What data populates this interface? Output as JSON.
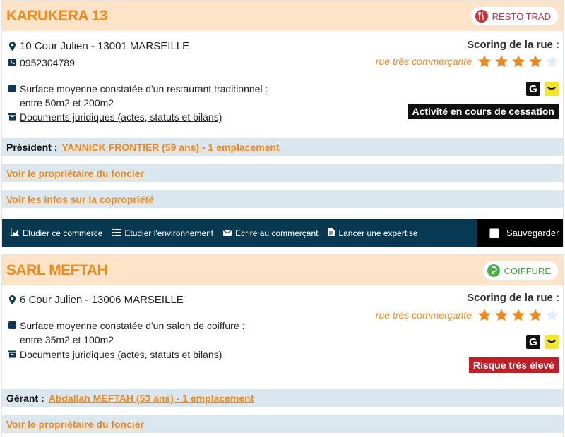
{
  "colors": {
    "accent": "#ee8a1d",
    "header_bg": "#fde4c9",
    "band_bg": "#dbe7ef",
    "toolbar_bg": "#073a52",
    "status_black": "#111111",
    "status_red": "#c31d25"
  },
  "cards": [
    {
      "title": "KARUKERA 13",
      "category": {
        "label": "RESTO TRAD",
        "icon": "cutlery-pin-icon"
      },
      "address": "10 Cour Julien - 13001 MARSEILLE",
      "phone": "0952304789",
      "surface_line1": "Surface moyenne constatée d'un restaurant traditionnel :",
      "surface_line2": "entre 50m2 et 200m2",
      "legal_docs": "Documents juridiques (actes, statuts et bilans)",
      "scoring_title": "Scoring de la rue :",
      "scoring_text": "rue très commerçante",
      "stars": 4,
      "stars_max": 5,
      "status": "Activité en cours de cessation",
      "role_label": "Président :",
      "role_link": "YANNICK FRONTIER (59 ans) - 1 emplacement",
      "link_owner": "Voir le propriétaire du foncier",
      "link_copro": "Voir les infos sur la copropriété",
      "toolbar": {
        "study_shop": "Etudier ce commerce",
        "study_env": "Etudier l'environnement",
        "write": "Ecrire au commerçant",
        "expertise": "Lancer une expertise",
        "save": "Sauvegarder"
      }
    },
    {
      "title": "SARL MEFTAH",
      "category": {
        "label": "COIFFURE",
        "icon": "hairdresser-pin-icon"
      },
      "address": "6 Cour Julien - 13006 MARSEILLE",
      "surface_line1": "Surface moyenne constatée d'un salon de coiffure :",
      "surface_line2": "entre 35m2 et 100m2",
      "legal_docs": "Documents juridiques (actes, statuts et bilans)",
      "scoring_title": "Scoring de la rue :",
      "scoring_text": "rue très commerçante",
      "stars": 4,
      "stars_max": 5,
      "status": "Risque très élevé",
      "role_label": "Gérant :",
      "role_link": "Abdallah MEFTAH (53 ans) - 1 emplacement",
      "link_owner": "Voir le propriétaire du foncier"
    }
  ]
}
